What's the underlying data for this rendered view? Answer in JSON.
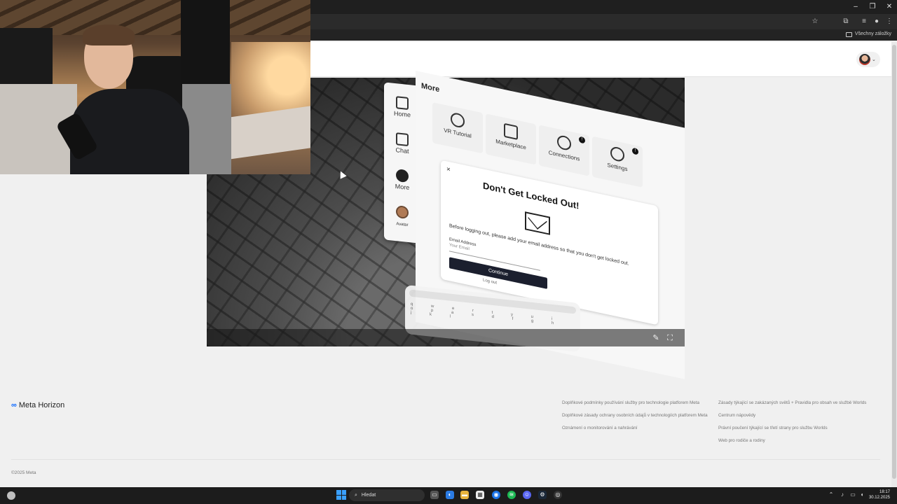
{
  "browser": {
    "window_controls": [
      "–",
      "❐",
      "✕"
    ],
    "bookmarks_all_label": "Všechny záložky"
  },
  "vr_menu": {
    "sidebar": [
      {
        "label": "Home",
        "icon": "home-icon"
      },
      {
        "label": "Chat",
        "icon": "chat-icon"
      },
      {
        "label": "More",
        "icon": "more-icon"
      },
      {
        "label": "Avatar",
        "icon": "avatar-icon"
      }
    ],
    "title": "More",
    "tiles": [
      {
        "label": "VR Tutorial",
        "icon": "tutorial-icon",
        "badge": ""
      },
      {
        "label": "Marketplace",
        "icon": "bag-icon",
        "badge": ""
      },
      {
        "label": "Connections",
        "icon": "people-icon",
        "badge": "!"
      },
      {
        "label": "Settings",
        "icon": "gear-icon",
        "badge": "!"
      }
    ],
    "dialog": {
      "close": "×",
      "title": "Don't Get Locked Out!",
      "body": "Before logging out, please add your email address so that you don't get locked out.",
      "email_label": "Email Address",
      "email_placeholder": "Your Email",
      "continue_label": "Continue",
      "logout_label": "Log out"
    },
    "keyboard_keys": "q w e r t y u i o p a s d f g h j k l"
  },
  "video_controls": {
    "pin_icon": "pin-icon",
    "fullscreen_icon": "fullscreen-icon"
  },
  "footer": {
    "logo_text": "Meta Horizon",
    "links_col1": [
      "Doplňkové podmínky používání služby pro technologie platforem Meta",
      "Doplňkové zásady ochrany osobních údajů v technologiích platforem Meta",
      "Oznámení o monitorování a nahrávání"
    ],
    "links_col2": [
      "Zásady týkající se zakázaných světů + Pravidla pro obsah ve službě Worlds",
      "Centrum nápovědy",
      "Právní poučení týkající se třetí strany pro službu Worlds",
      "Web pro rodiče a rodiny"
    ],
    "copyright": "©2025 Meta"
  },
  "taskbar": {
    "search_placeholder": "Hledat",
    "time": "18:17",
    "date": "30.12.2025"
  }
}
